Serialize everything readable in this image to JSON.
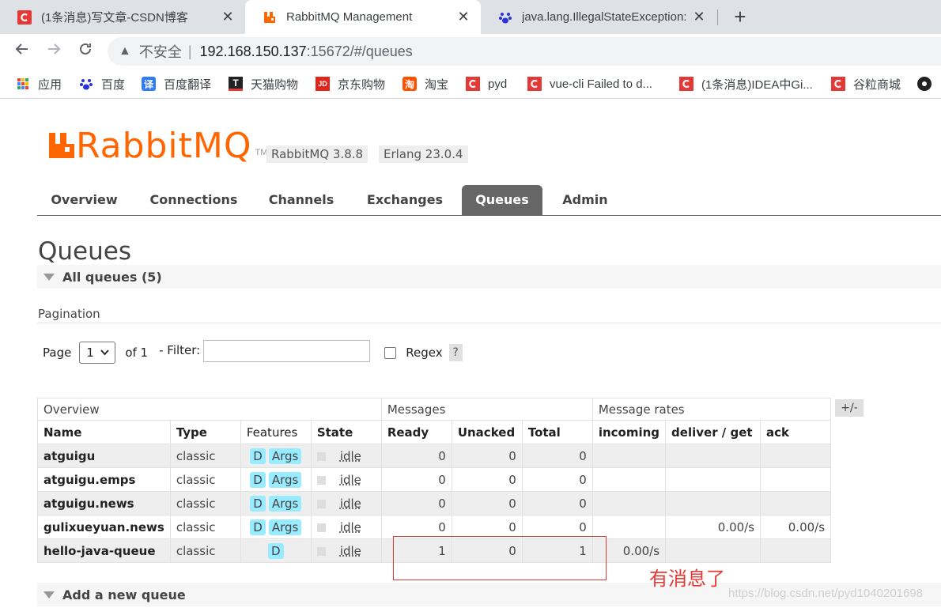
{
  "browser": {
    "tabs": [
      {
        "title": "(1条消息)写文章-CSDN博客",
        "icon": "csdn-icon",
        "color": "#e53935"
      },
      {
        "title": "RabbitMQ Management",
        "icon": "rabbitmq-icon",
        "color": "#ff6600"
      },
      {
        "title": "java.lang.IllegalStateException:",
        "icon": "baidu-paw-icon",
        "color": "#2932e1"
      }
    ],
    "close_glyph": "✕",
    "new_tab_glyph": "+",
    "address": {
      "warning_glyph": "▲",
      "insecure_label": "不安全",
      "separator": "|",
      "host": "192.168.150.137",
      "rest": ":15672/#/queues"
    },
    "bookmarks": [
      {
        "label": "应用",
        "icon": "apps-grid-icon"
      },
      {
        "label": "百度",
        "icon": "baidu-paw-icon"
      },
      {
        "label": "百度翻译",
        "icon": "baidu-translate-icon"
      },
      {
        "label": "天猫购物",
        "icon": "tmall-icon"
      },
      {
        "label": "京东购物",
        "icon": "jd-icon"
      },
      {
        "label": "淘宝",
        "icon": "taobao-icon"
      },
      {
        "label": "pyd",
        "icon": "csdn-icon"
      },
      {
        "label": "vue-cli Failed to d...",
        "icon": "csdn-icon"
      },
      {
        "label": "(1条消息)IDEA中Gi...",
        "icon": "csdn-icon"
      },
      {
        "label": "谷粒商城",
        "icon": "csdn-icon"
      }
    ]
  },
  "app": {
    "logo_text": "RabbitMQ",
    "logo_tm": "TM",
    "versions": [
      "RabbitMQ 3.8.8",
      "Erlang 23.0.4"
    ],
    "nav": [
      "Overview",
      "Connections",
      "Channels",
      "Exchanges",
      "Queues",
      "Admin"
    ],
    "active_nav": "Queues",
    "page_title": "Queues",
    "all_queues_label": "All queues (5)",
    "pagination": {
      "title": "Pagination",
      "page_label": "Page",
      "page_value": "1",
      "of_label": "of 1",
      "filter_label": "- Filter:",
      "filter_value": "",
      "regex_label": "Regex",
      "help_label": "?"
    },
    "table": {
      "groups": [
        "Overview",
        "Messages",
        "Message rates"
      ],
      "columns": [
        "Name",
        "Type",
        "Features",
        "State",
        "Ready",
        "Unacked",
        "Total",
        "incoming",
        "deliver / get",
        "ack"
      ],
      "rows": [
        {
          "name": "atguigu",
          "type": "classic",
          "features": [
            "D",
            "Args"
          ],
          "state": "idle",
          "ready": "0",
          "unacked": "0",
          "total": "0",
          "incoming": "",
          "deliver_get": "",
          "ack": ""
        },
        {
          "name": "atguigu.emps",
          "type": "classic",
          "features": [
            "D",
            "Args"
          ],
          "state": "idle",
          "ready": "0",
          "unacked": "0",
          "total": "0",
          "incoming": "",
          "deliver_get": "",
          "ack": ""
        },
        {
          "name": "atguigu.news",
          "type": "classic",
          "features": [
            "D",
            "Args"
          ],
          "state": "idle",
          "ready": "0",
          "unacked": "0",
          "total": "0",
          "incoming": "",
          "deliver_get": "",
          "ack": ""
        },
        {
          "name": "gulixueyuan.news",
          "type": "classic",
          "features": [
            "D",
            "Args"
          ],
          "state": "idle",
          "ready": "0",
          "unacked": "0",
          "total": "0",
          "incoming": "",
          "deliver_get": "0.00/s",
          "ack": "0.00/s"
        },
        {
          "name": "hello-java-queue",
          "type": "classic",
          "features": [
            "D"
          ],
          "state": "idle",
          "ready": "1",
          "unacked": "0",
          "total": "1",
          "incoming": "0.00/s",
          "deliver_get": "",
          "ack": ""
        }
      ],
      "plus_minus": "+/-"
    },
    "add_queue_label": "Add a new queue"
  },
  "annotation": {
    "text": "有消息了",
    "color": "#e53935"
  },
  "watermark": "https://blog.csdn.net/pyd1040201698"
}
